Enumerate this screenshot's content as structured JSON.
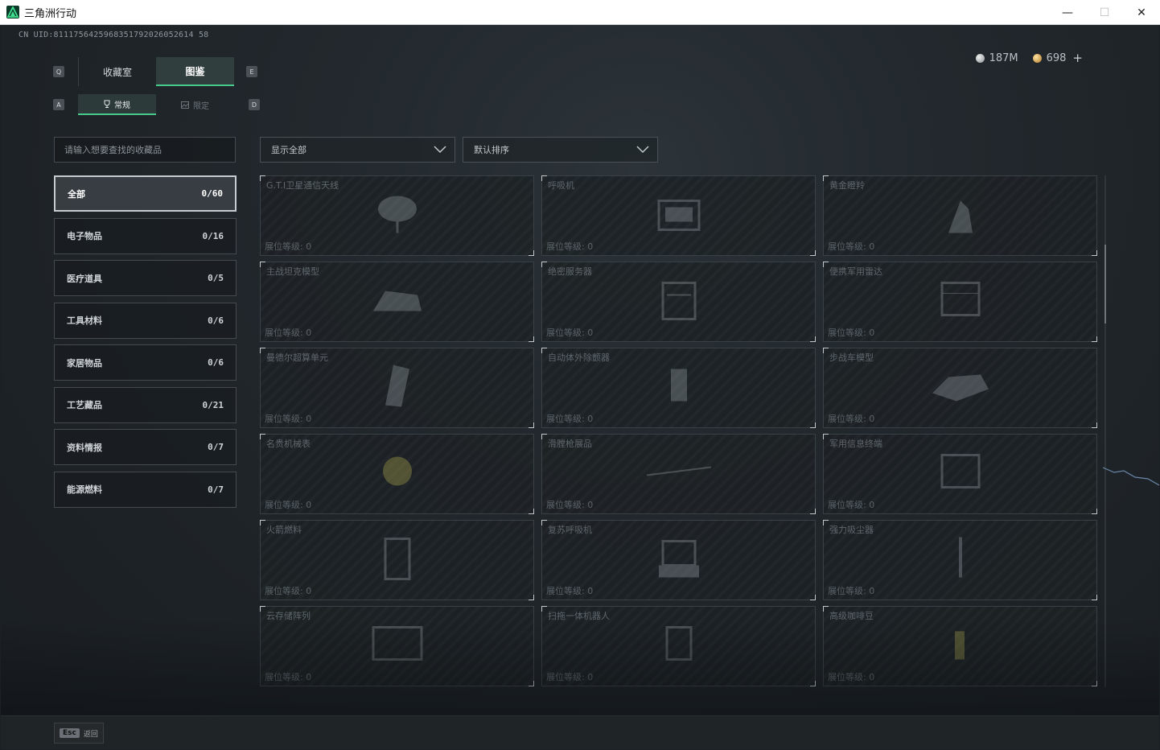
{
  "window": {
    "title": "三角洲行动",
    "minimize": "—",
    "maximize": "☐",
    "close": "✕"
  },
  "uid": "CN UID:8111756425968351792026052614 58",
  "currency": [
    {
      "icon": "silver-coin-icon",
      "value": "187M"
    },
    {
      "icon": "gold-coin-icon",
      "value": "698"
    }
  ],
  "currency_plus": "+",
  "keys": {
    "q": "Q",
    "e": "E",
    "a": "A",
    "d": "D"
  },
  "main_tabs": [
    {
      "label": "收藏室",
      "active": false
    },
    {
      "label": "图鉴",
      "active": true
    }
  ],
  "sub_tabs": [
    {
      "label": "常规",
      "icon": "trophy-icon",
      "active": true
    },
    {
      "label": "限定",
      "icon": "image-icon",
      "active": false
    }
  ],
  "search": {
    "placeholder": "请输入想要查找的收藏品"
  },
  "filter": {
    "selected": "显示全部"
  },
  "sort": {
    "selected": "默认排序"
  },
  "categories": [
    {
      "label": "全部",
      "count": "0/60",
      "active": true
    },
    {
      "label": "电子物品",
      "count": "0/16"
    },
    {
      "label": "医疗道具",
      "count": "0/5"
    },
    {
      "label": "工具材料",
      "count": "0/6"
    },
    {
      "label": "家居物品",
      "count": "0/6"
    },
    {
      "label": "工艺藏品",
      "count": "0/21"
    },
    {
      "label": "资料情报",
      "count": "0/7"
    },
    {
      "label": "能源燃料",
      "count": "0/7"
    }
  ],
  "level_label": "展位等级: 0",
  "items": [
    {
      "name": "G.T.I卫星通信天线",
      "icon": "satellite-dish-icon"
    },
    {
      "name": "呼吸机",
      "icon": "ventilator-icon"
    },
    {
      "name": "黄金瞪羚",
      "icon": "gazelle-statue-icon"
    },
    {
      "name": "主战坦克模型",
      "icon": "tank-model-icon"
    },
    {
      "name": "绝密服务器",
      "icon": "server-icon"
    },
    {
      "name": "便携军用雷达",
      "icon": "radar-icon"
    },
    {
      "name": "曼德尔超算单元",
      "icon": "compute-unit-icon"
    },
    {
      "name": "自动体外除颤器",
      "icon": "defibrillator-icon"
    },
    {
      "name": "步战车模型",
      "icon": "ifv-model-icon"
    },
    {
      "name": "名贵机械表",
      "icon": "watch-icon"
    },
    {
      "name": "滑膛枪展品",
      "icon": "musket-icon"
    },
    {
      "name": "军用信息终端",
      "icon": "terminal-icon"
    },
    {
      "name": "火箭燃料",
      "icon": "rocket-fuel-icon"
    },
    {
      "name": "复苏呼吸机",
      "icon": "resuscitator-icon"
    },
    {
      "name": "强力吸尘器",
      "icon": "vacuum-icon"
    },
    {
      "name": "云存储阵列",
      "icon": "storage-array-icon"
    },
    {
      "name": "扫拖一体机器人",
      "icon": "robot-vacuum-icon"
    },
    {
      "name": "高级咖啡豆",
      "icon": "coffee-beans-icon"
    }
  ],
  "bottom": {
    "esc_key": "Esc",
    "esc_label": "返回"
  },
  "colors": {
    "accent": "#47c98c",
    "background": "#1b2024"
  }
}
